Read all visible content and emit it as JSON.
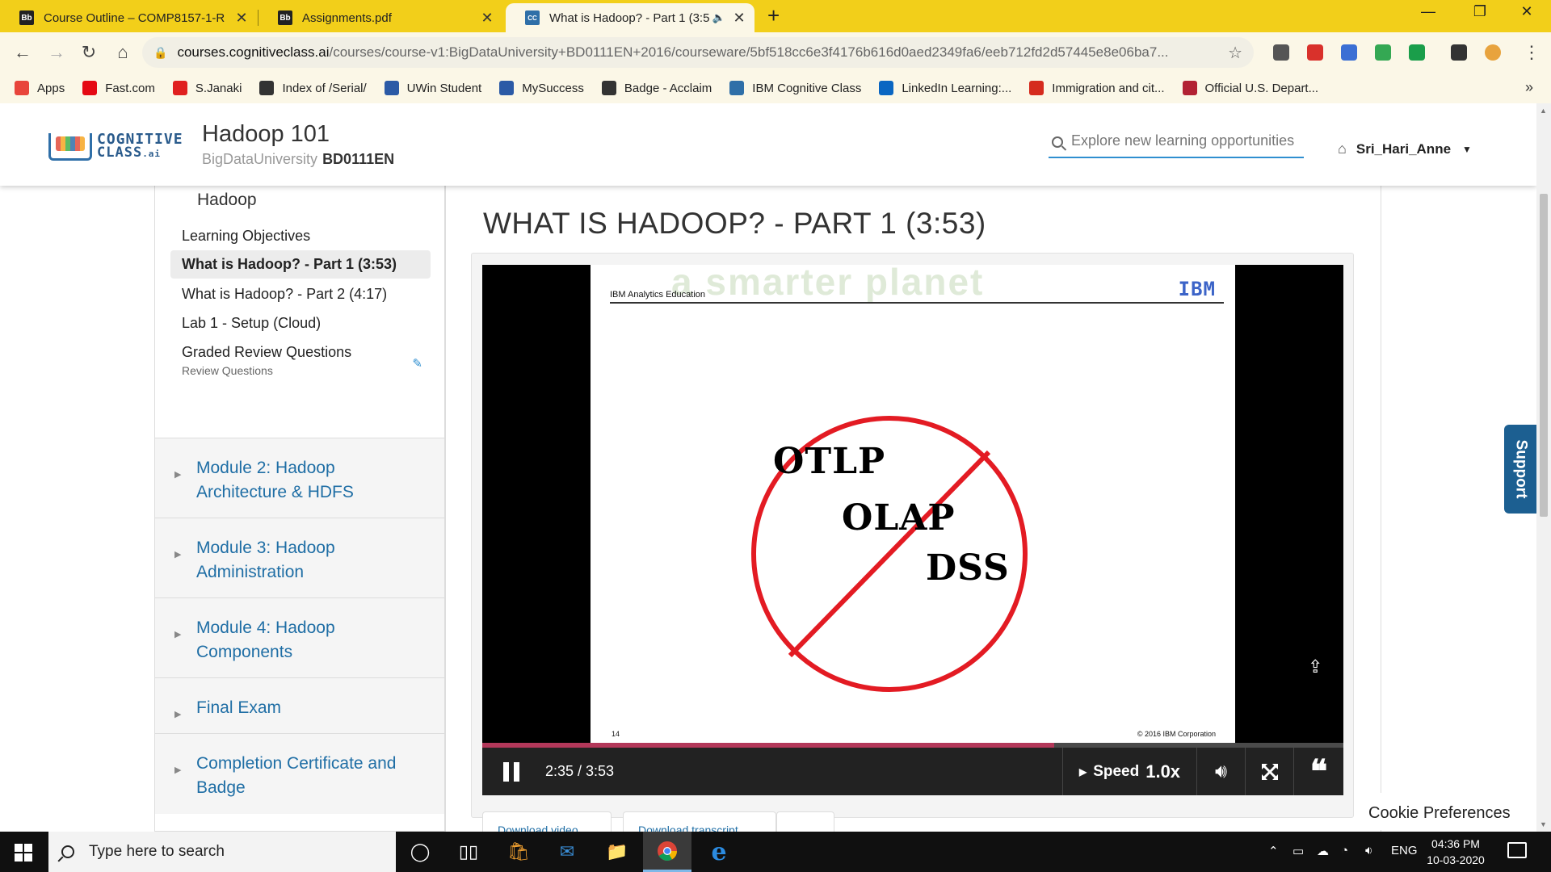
{
  "browser": {
    "tabs": [
      {
        "favicon": "Bb",
        "title": "Course Outline – COMP8157-1-R",
        "close": "✕"
      },
      {
        "favicon": "Bb",
        "title": "Assignments.pdf",
        "close": "✕"
      },
      {
        "favicon": "CC",
        "title": "What is Hadoop? - Part 1 (3:5",
        "close": "✕"
      }
    ],
    "new_tab": "+",
    "window": {
      "minimize": "—",
      "restore": "❐",
      "close": "✕"
    },
    "nav": {
      "back": "←",
      "forward": "→",
      "reload": "↻",
      "home": "⌂"
    },
    "url_host": "courses.cognitiveclass.ai",
    "url_path": "/courses/course-v1:BigDataUniversity+BD0111EN+2016/courseware/5bf518cc6e3f4176b616d0aed2349fa6/eeb712fd2d57445e8e06ba7...",
    "star": "☆",
    "menu": "⋮",
    "extensions": [
      "#555555",
      "#d9312b",
      "#3b6fd4",
      "#34a853",
      "#1a9e4a",
      "#333333",
      "#e8a33d"
    ],
    "bookmarks": [
      {
        "label": "Apps",
        "icon": "apps-icon",
        "color": "#e8453c"
      },
      {
        "label": "Fast.com",
        "icon": "fast-icon",
        "color": "#e50914"
      },
      {
        "label": "S.Janaki",
        "icon": "a-icon",
        "color": "#e02020"
      },
      {
        "label": "Index of /Serial/",
        "icon": "globe-icon",
        "color": "#333333"
      },
      {
        "label": "UWin Student",
        "icon": "uwin-icon",
        "color": "#2b5aa6"
      },
      {
        "label": "MySuccess",
        "icon": "uwin-icon",
        "color": "#2b5aa6"
      },
      {
        "label": "Badge - Acclaim",
        "icon": "globe-icon",
        "color": "#333333"
      },
      {
        "label": "IBM Cognitive Class",
        "icon": "cc-icon",
        "color": "#2f6fa8"
      },
      {
        "label": "LinkedIn Learning:...",
        "icon": "linkedin-icon",
        "color": "#0a66c2"
      },
      {
        "label": "Immigration and cit...",
        "icon": "maple-leaf-icon",
        "color": "#d52b1e"
      },
      {
        "label": "Official U.S. Depart...",
        "icon": "us-flag-icon",
        "color": "#b22234"
      }
    ],
    "bookmarks_more": "»"
  },
  "header": {
    "logo_line1": "COGNITIVE",
    "logo_line2": "CLASS",
    "logo_suffix": ".ai",
    "course_title": "Hadoop 101",
    "org": "BigDataUniversity",
    "course_code": "BD0111EN",
    "search_placeholder": "Explore new learning opportunities",
    "username": "Sri_Hari_Anne"
  },
  "sidebar": {
    "section": "Hadoop",
    "lessons": [
      {
        "label": "Learning Objectives"
      },
      {
        "label": "What is Hadoop? - Part 1 (3:53)"
      },
      {
        "label": "What is Hadoop? - Part 2 (4:17)"
      },
      {
        "label": "Lab 1 - Setup (Cloud)"
      },
      {
        "label": "Graded Review Questions",
        "sub": "Review Questions"
      }
    ],
    "modules": [
      {
        "line1": "Module 2: Hadoop",
        "line2": "Architecture & HDFS"
      },
      {
        "line1": "Module 3: Hadoop",
        "line2": "Administration"
      },
      {
        "line1": "Module 4: Hadoop",
        "line2": "Components"
      },
      {
        "line1": "Final Exam",
        "line2": ""
      },
      {
        "line1": "Completion Certificate and",
        "line2": "Badge"
      }
    ]
  },
  "unit": {
    "title": "WHAT IS HADOOP? - PART 1 (3:53)"
  },
  "video": {
    "slide": {
      "header": "IBM Analytics Education",
      "watermark": "a smarter planet",
      "logo": "IBM",
      "words": [
        "OTLP",
        "OLAP",
        "DSS"
      ],
      "page_number": "14",
      "copyright": "© 2016 IBM Corporation",
      "sign_color": "#e31b23"
    },
    "progress": 0.664,
    "time": "2:35 / 3:53",
    "speed_label": "Speed",
    "speed_value": "1.0x",
    "cc_symbol": "❝"
  },
  "download_tabs": [
    "Download video",
    "Download transcript",
    ""
  ],
  "support_label": "Support",
  "cookie_label": "Cookie Preferences",
  "taskbar": {
    "search_placeholder": "Type here to search",
    "tray_lang": "ENG",
    "time": "04:36 PM",
    "date": "10-03-2020"
  }
}
